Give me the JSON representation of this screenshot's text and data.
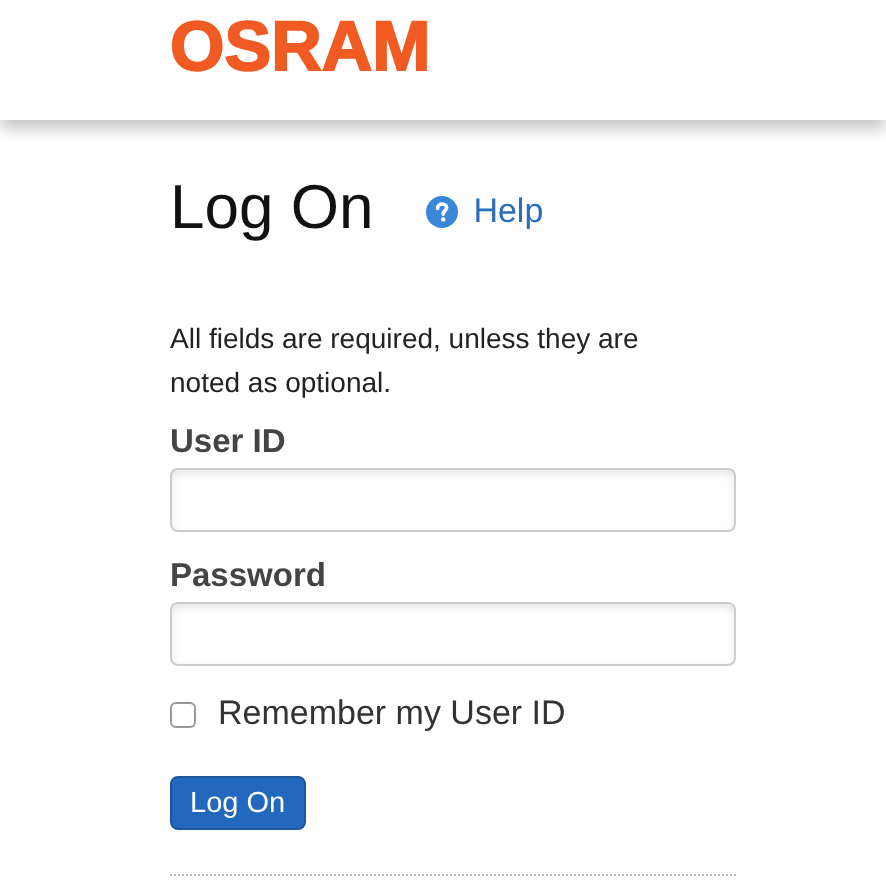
{
  "header": {
    "logo": "OSRAM"
  },
  "title": "Log On",
  "help_link": "Help",
  "intro": "All fields are required, unless they are noted as optional.",
  "fields": [
    {
      "label": "User ID"
    },
    {
      "label": "Password"
    }
  ],
  "remember": {
    "label": "Remember my User ID",
    "checked": false
  },
  "submit": "Log On"
}
